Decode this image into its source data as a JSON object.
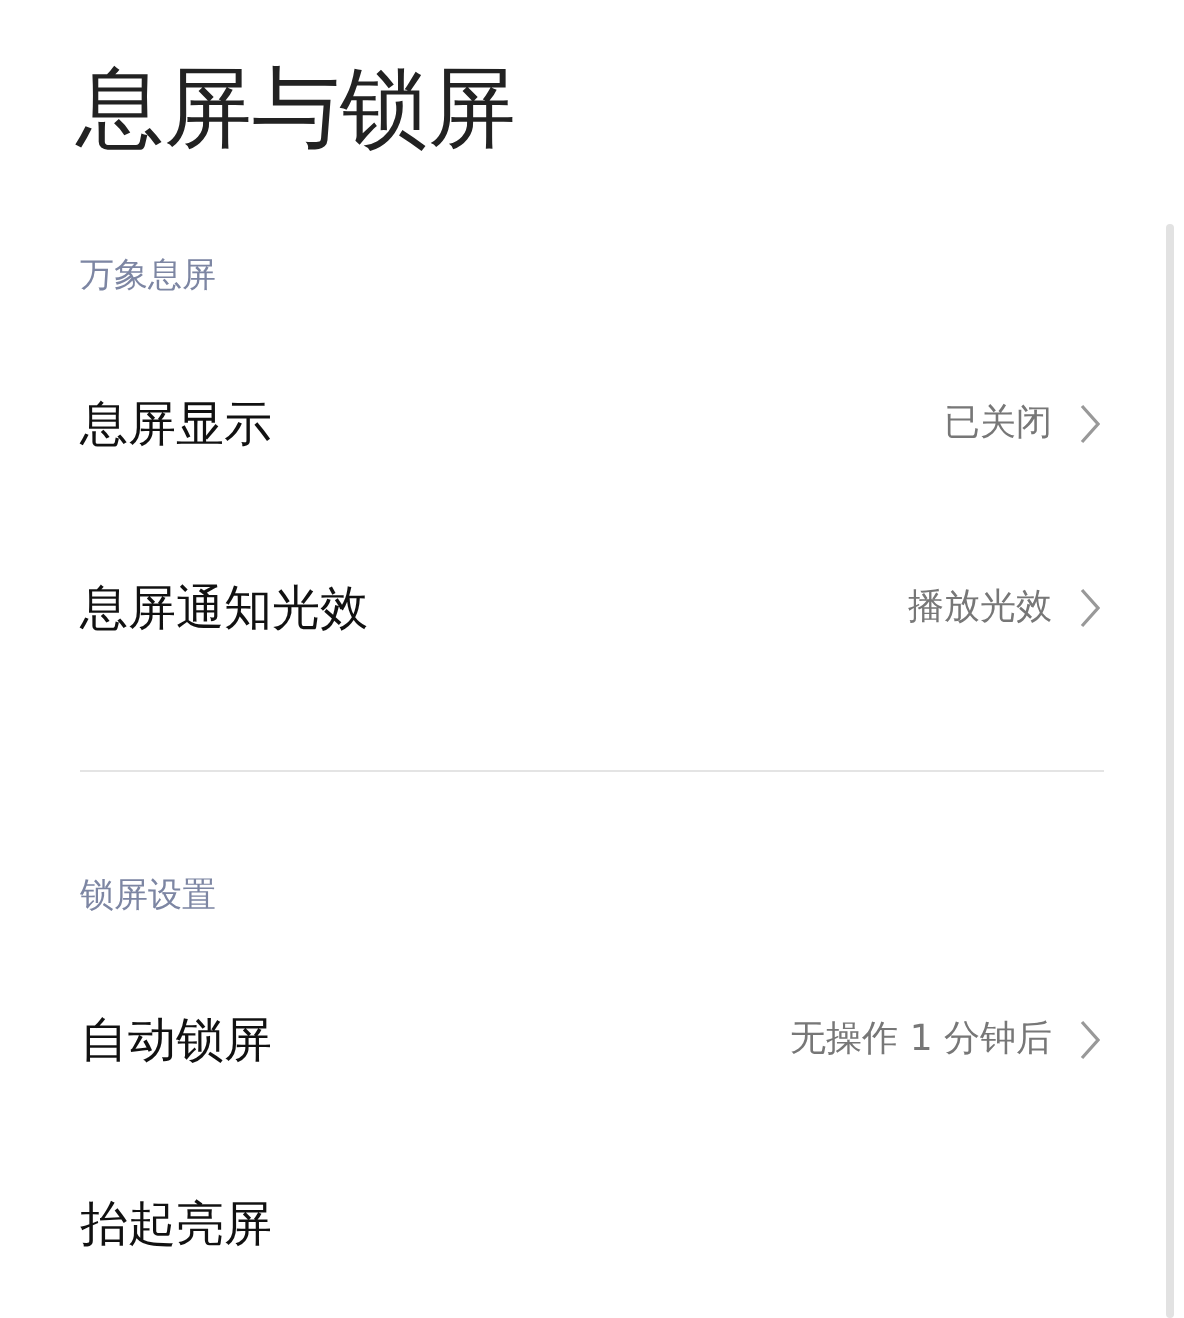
{
  "title": "息屏与锁屏",
  "sections": [
    {
      "header": "万象息屏",
      "items": [
        {
          "kind": "link",
          "label": "息屏显示",
          "value": "已关闭"
        },
        {
          "kind": "link",
          "label": "息屏通知光效",
          "value": "播放光效"
        }
      ]
    },
    {
      "header": "锁屏设置",
      "items": [
        {
          "kind": "link",
          "label": "自动锁屏",
          "value": "无操作 1 分钟后"
        },
        {
          "kind": "plain",
          "label": "抬起亮屏"
        }
      ]
    }
  ]
}
